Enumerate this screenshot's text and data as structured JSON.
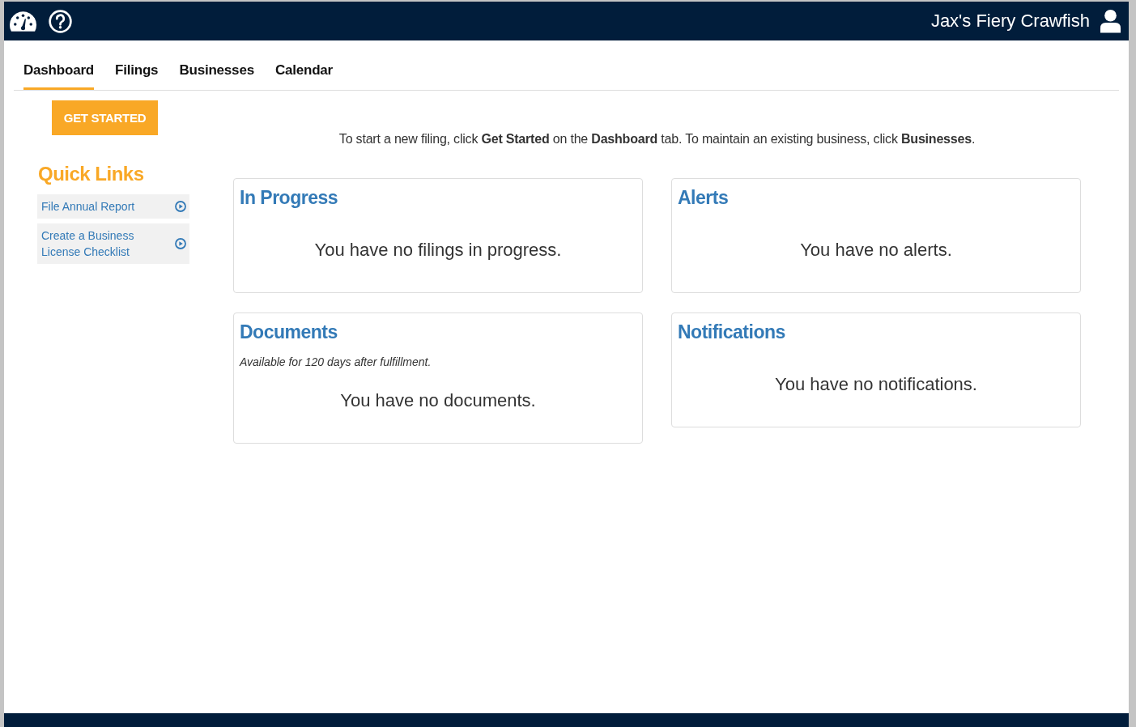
{
  "header": {
    "account_name": "Jax's Fiery Crawfish"
  },
  "tabs": [
    {
      "label": "Dashboard",
      "selected": true
    },
    {
      "label": "Filings",
      "selected": false
    },
    {
      "label": "Businesses",
      "selected": false
    },
    {
      "label": "Calendar",
      "selected": false
    }
  ],
  "get_started_button": "GET STARTED",
  "intro": "To start a new filing, click **Get Started** on the **Dashboard** tab. To maintain an existing business, click **Businesses**.",
  "quick_links": {
    "title": "Quick Links",
    "items": [
      {
        "label": "File Annual Report"
      },
      {
        "label": "Create a Business License Checklist"
      }
    ]
  },
  "cards": [
    {
      "title": "In Progress",
      "message": "You have no filings in progress."
    },
    {
      "title": "Alerts",
      "message": "You have no alerts."
    },
    {
      "title": "Documents",
      "note": "Available for 120 days after fulfillment.",
      "message": "You have no documents."
    },
    {
      "title": "Notifications",
      "message": "You have no notifications."
    }
  ]
}
